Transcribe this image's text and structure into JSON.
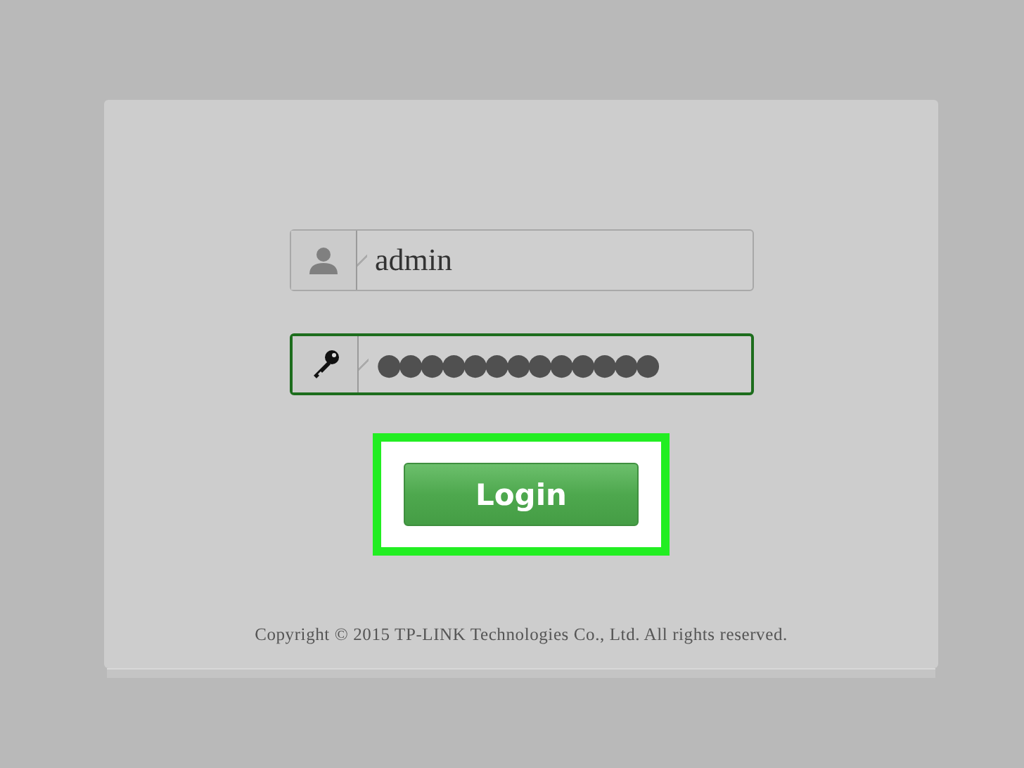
{
  "login_form": {
    "fields": [
      {
        "kind": "username",
        "value": "admin",
        "focused": false
      },
      {
        "kind": "password",
        "value": "●●●●●●●●●●●●●",
        "focused": true
      }
    ],
    "button": {
      "label": "Login",
      "highlighted": true
    },
    "copyright": "Copyright © 2015 TP-LINK Technologies Co., Ltd. All rights reserved."
  }
}
